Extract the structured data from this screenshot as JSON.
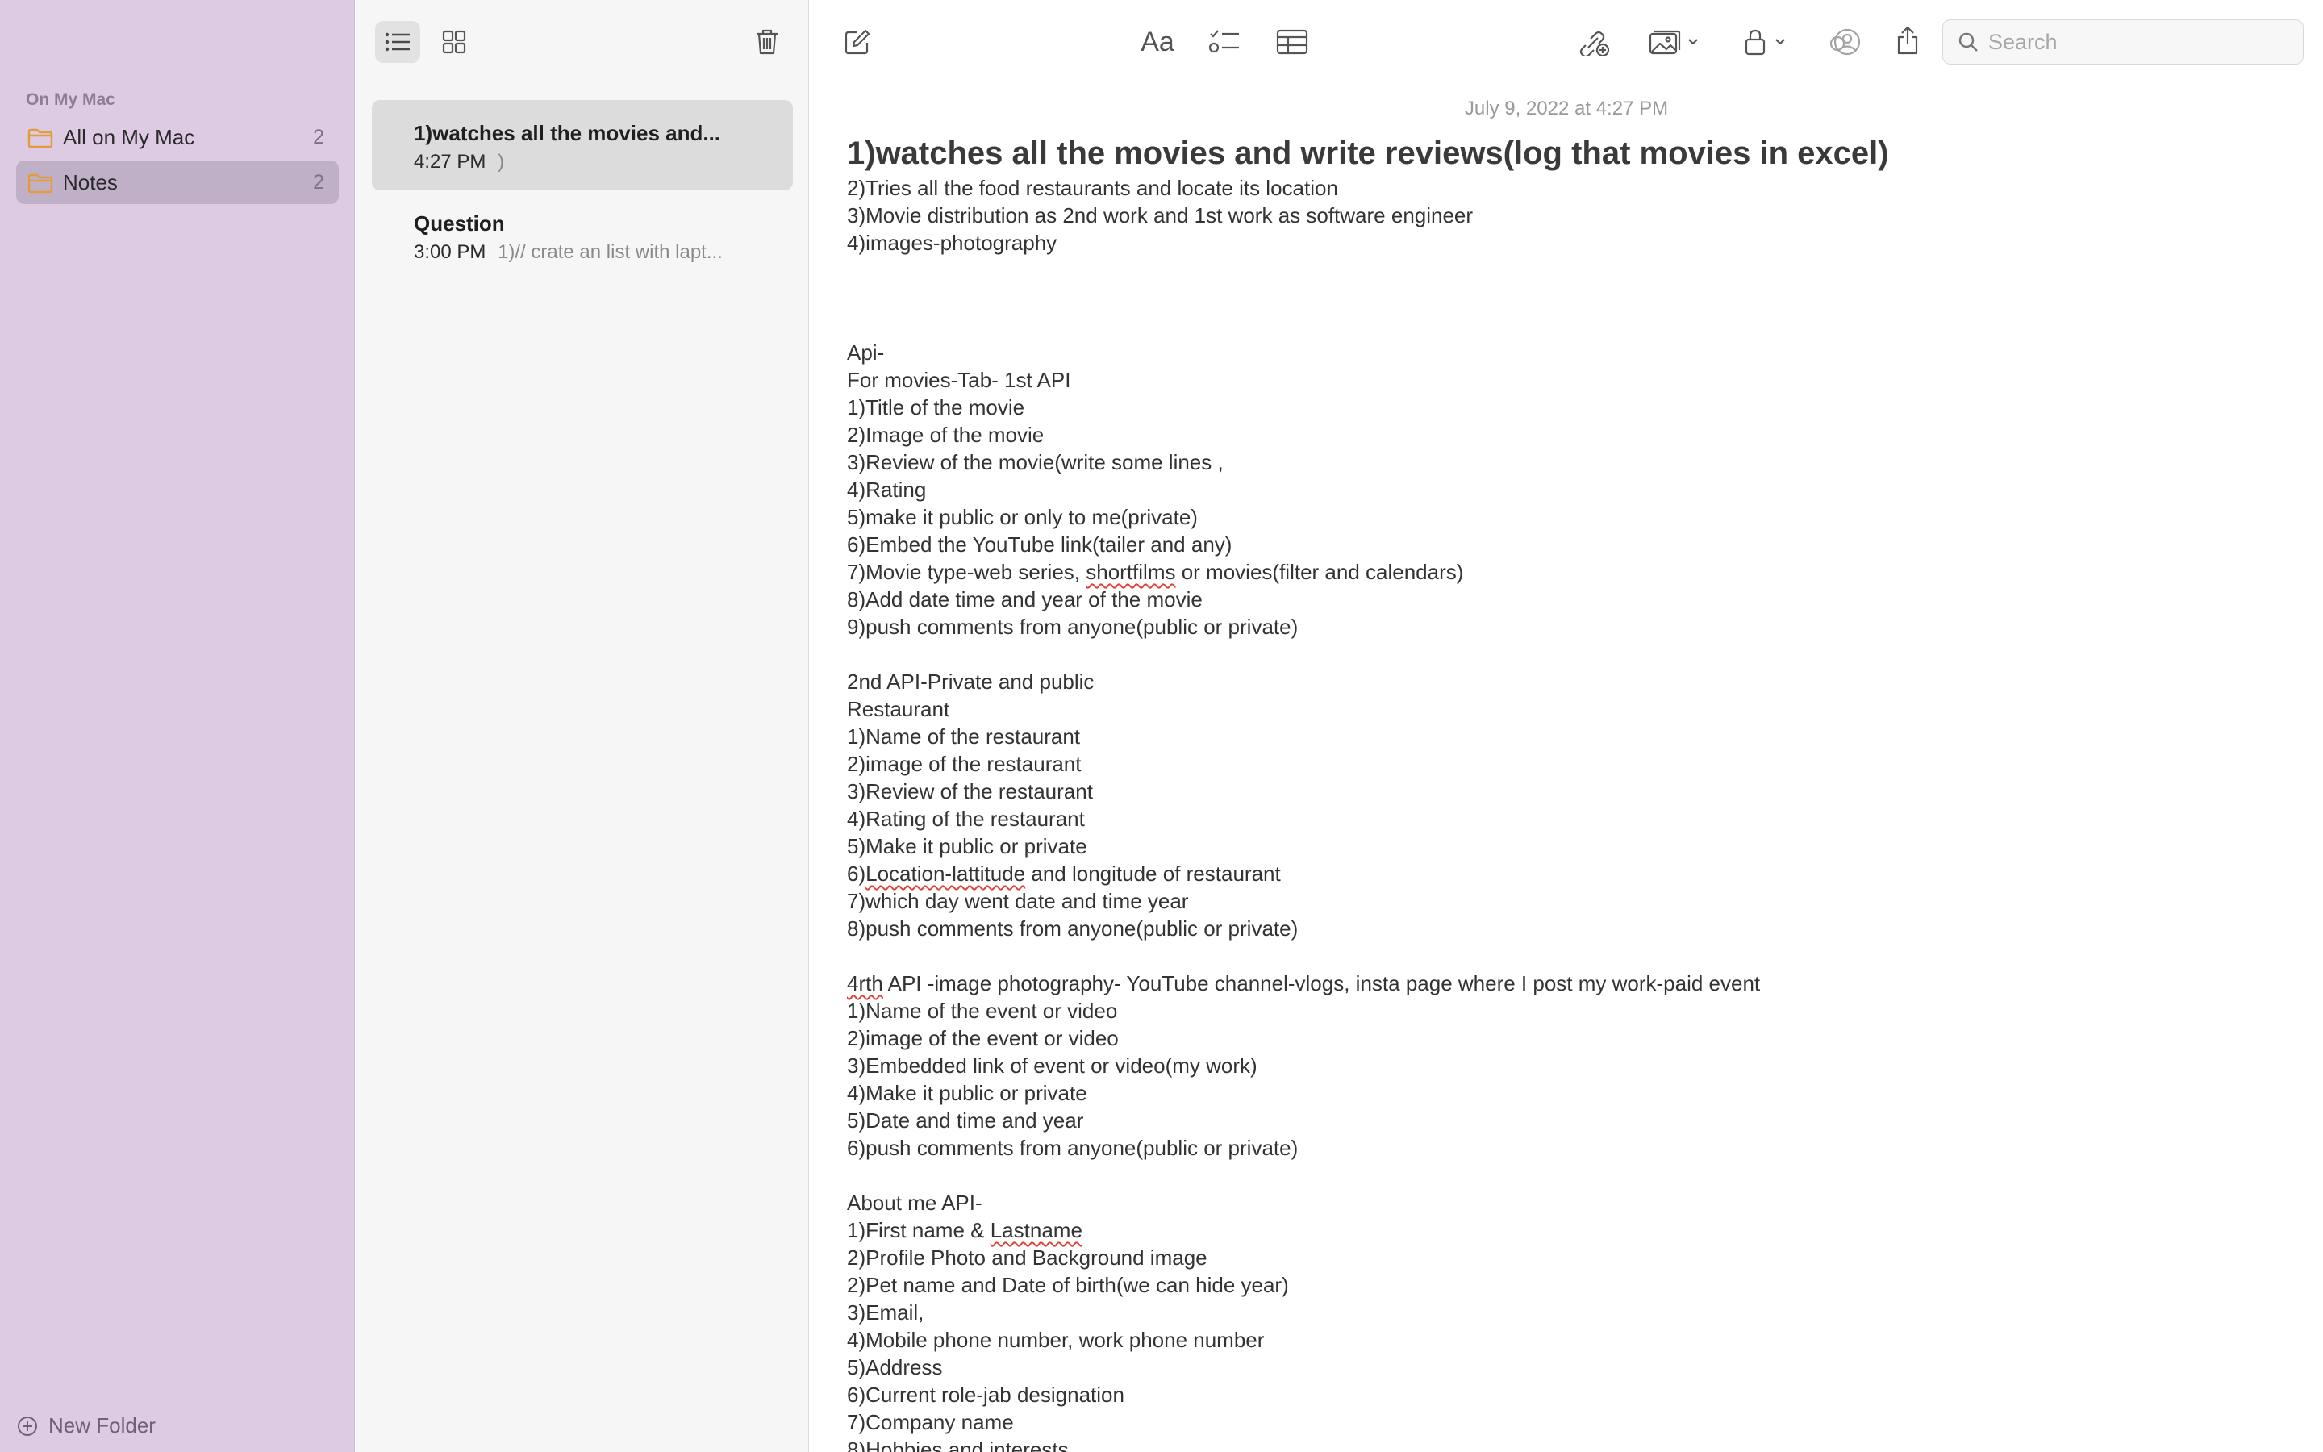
{
  "sidebar": {
    "section_title": "On My Mac",
    "folders": [
      {
        "label": "All on My Mac",
        "count": "2",
        "selected": false
      },
      {
        "label": "Notes",
        "count": "2",
        "selected": true
      }
    ],
    "new_folder_label": "New Folder",
    "icons": {
      "folder": "folder-icon",
      "add": "plus-circle-icon"
    },
    "colors": {
      "background": "#dccbe3",
      "folder_icon": "#e39b3b",
      "selected": "#bfb0c8"
    }
  },
  "note_list": {
    "toolbar_icons": [
      "list-view-icon",
      "gallery-view-icon",
      "trash-icon"
    ],
    "notes": [
      {
        "title": "1)watches all the movies and...",
        "time": "4:27 PM",
        "preview": ")",
        "selected": true
      },
      {
        "title": "Question",
        "time": "3:00 PM",
        "preview": "1)// crate an list with lapt...",
        "selected": false
      }
    ]
  },
  "editor": {
    "toolbar_icons": [
      "compose-icon",
      "format-text-icon",
      "checklist-icon",
      "table-icon",
      "collaborate-icon",
      "media-icon",
      "lock-icon",
      "share-people-icon",
      "share-icon"
    ],
    "format_label": "Aa",
    "search": {
      "placeholder": "Search",
      "value": ""
    },
    "date": "July 9, 2022 at 4:27 PM",
    "title": "1)watches all the movies and write reviews(log that movies in excel)",
    "lines": [
      "2)Tries all the food restaurants  and locate its location",
      "3)Movie distribution as 2nd work and 1st work as software engineer",
      "4)images-photography",
      "",
      "",
      "",
      "Api-",
      "For movies-Tab- 1st API",
      "1)Title of the movie",
      "2)Image of the movie",
      "3)Review of the movie(write some lines ,",
      "4)Rating",
      "5)make it public or only to me(private)",
      "6)Embed the YouTube link(tailer and any)",
      "7)Movie type-web series, shortfilms or movies(filter and calendars)",
      "8)Add date time and year of the movie",
      "9)push comments from anyone(public or private)",
      "",
      "2nd API-Private and public",
      "Restaurant",
      "1)Name of the restaurant",
      "2)image of the restaurant",
      "3)Review of the restaurant",
      "4)Rating of the restaurant",
      "5)Make it public or private",
      "6)Location-lattitude and longitude of restaurant",
      "7)which day went date and time year",
      "8)push comments from anyone(public or private)",
      "",
      "4rth API -image photography- YouTube channel-vlogs, insta page where I post my work-paid event",
      "1)Name of the event or video",
      "2)image of the event or video",
      "3)Embedded link of event or video(my work)",
      "4)Make it public or private",
      "5)Date and time  and year",
      "6)push comments from anyone(public or private)",
      "",
      "About me API-",
      "1)First name & Lastname",
      "2)Profile Photo and Background image",
      "2)Pet name and Date of birth(we can hide year)",
      "3)Email,",
      "4)Mobile phone number, work phone number",
      "5)Address",
      "6)Current role-jab designation",
      "7)Company name",
      "8)Hobbies and interests"
    ],
    "misspelled": [
      "shortfilms",
      "Location-lattitude",
      "4rth",
      "Lastname"
    ]
  }
}
